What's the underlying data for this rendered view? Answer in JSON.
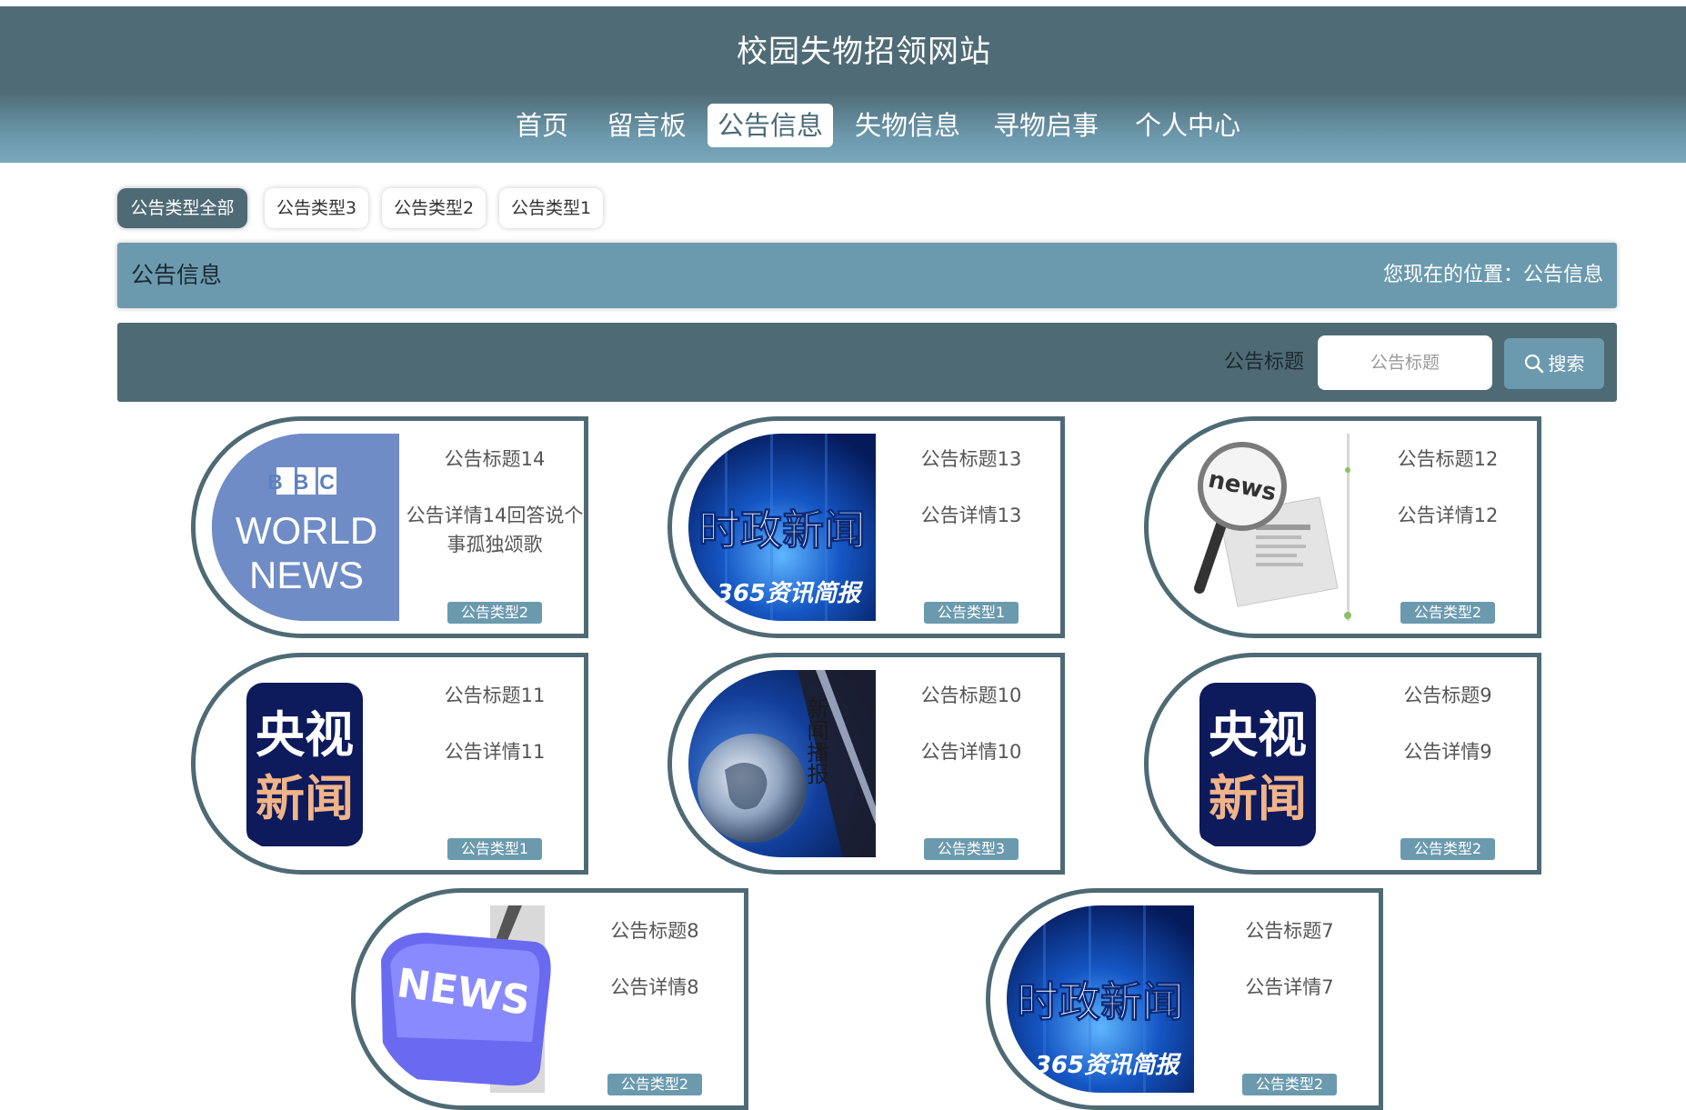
{
  "site": {
    "title": "校园失物招领网站"
  },
  "nav": {
    "items": [
      {
        "label": "首页"
      },
      {
        "label": "留言板"
      },
      {
        "label": "公告信息",
        "active": true
      },
      {
        "label": "失物信息"
      },
      {
        "label": "寻物启事"
      },
      {
        "label": "个人中心"
      }
    ]
  },
  "filters": [
    {
      "label": "公告类型全部",
      "active": true
    },
    {
      "label": "公告类型3"
    },
    {
      "label": "公告类型2"
    },
    {
      "label": "公告类型1"
    }
  ],
  "title_bar": {
    "title": "公告信息",
    "location": "您现在的位置：公告信息"
  },
  "search": {
    "label": "公告标题",
    "placeholder": "公告标题",
    "button_label": "搜索"
  },
  "colors": {
    "primary_dark": "#4e6a75",
    "primary_light": "#6b9aae"
  },
  "cards": [
    {
      "title": "公告标题14",
      "detail": "公告详情14回答说个事孤独颂歌",
      "type": "公告类型2",
      "image": "bbc-world-news-image",
      "image_text": [
        "BBC",
        "WORLD",
        "NEWS"
      ]
    },
    {
      "title": "公告标题13",
      "detail": "公告详情13",
      "type": "公告类型1",
      "image": "shizheng-news-image",
      "image_text": [
        "时政新闻",
        "365资讯简报"
      ]
    },
    {
      "title": "公告标题12",
      "detail": "公告详情12",
      "type": "公告类型2",
      "image": "magnifier-newspaper-image",
      "image_text": [
        "news"
      ]
    },
    {
      "title": "公告标题11",
      "detail": "公告详情11",
      "type": "公告类型1",
      "image": "cctv-news-image",
      "image_text": [
        "央视",
        "新闻"
      ]
    },
    {
      "title": "公告标题10",
      "detail": "公告详情10",
      "type": "公告类型3",
      "image": "globe-news-image",
      "image_text": [
        "新闻播报"
      ]
    },
    {
      "title": "公告标题9",
      "detail": "公告详情9",
      "type": "公告类型2",
      "image": "cctv-news-image",
      "image_text": [
        "央视",
        "新闻"
      ]
    },
    {
      "title": "公告标题8",
      "detail": "公告详情8",
      "type": "公告类型2",
      "image": "news-key-image",
      "image_text": [
        "NEWS"
      ]
    },
    {
      "title": "公告标题7",
      "detail": "公告详情7",
      "type": "公告类型2",
      "image": "shizheng-news-image",
      "image_text": [
        "时政新闻",
        "365资讯简报"
      ]
    }
  ]
}
